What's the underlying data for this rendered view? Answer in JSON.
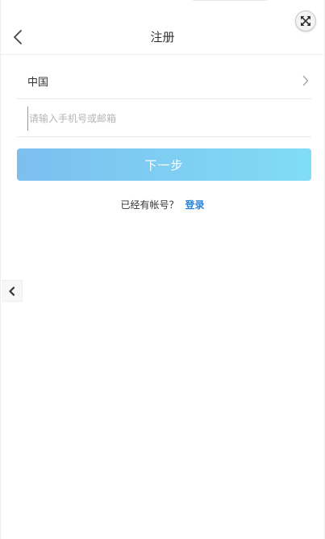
{
  "header": {
    "title": "注册",
    "back_icon": "chevron-left-icon",
    "expand_icon": "expand-arrows-icon"
  },
  "form": {
    "country": "中国",
    "phone_placeholder": "请输入手机号或邮箱",
    "phone_value": "",
    "next_label": "下一步"
  },
  "footer": {
    "have_account": "已经有帐号？",
    "login_label": "登录"
  },
  "colors": {
    "accent": "#2a84d8",
    "button_start": "#7cbfef",
    "button_end": "#80dcf6"
  }
}
